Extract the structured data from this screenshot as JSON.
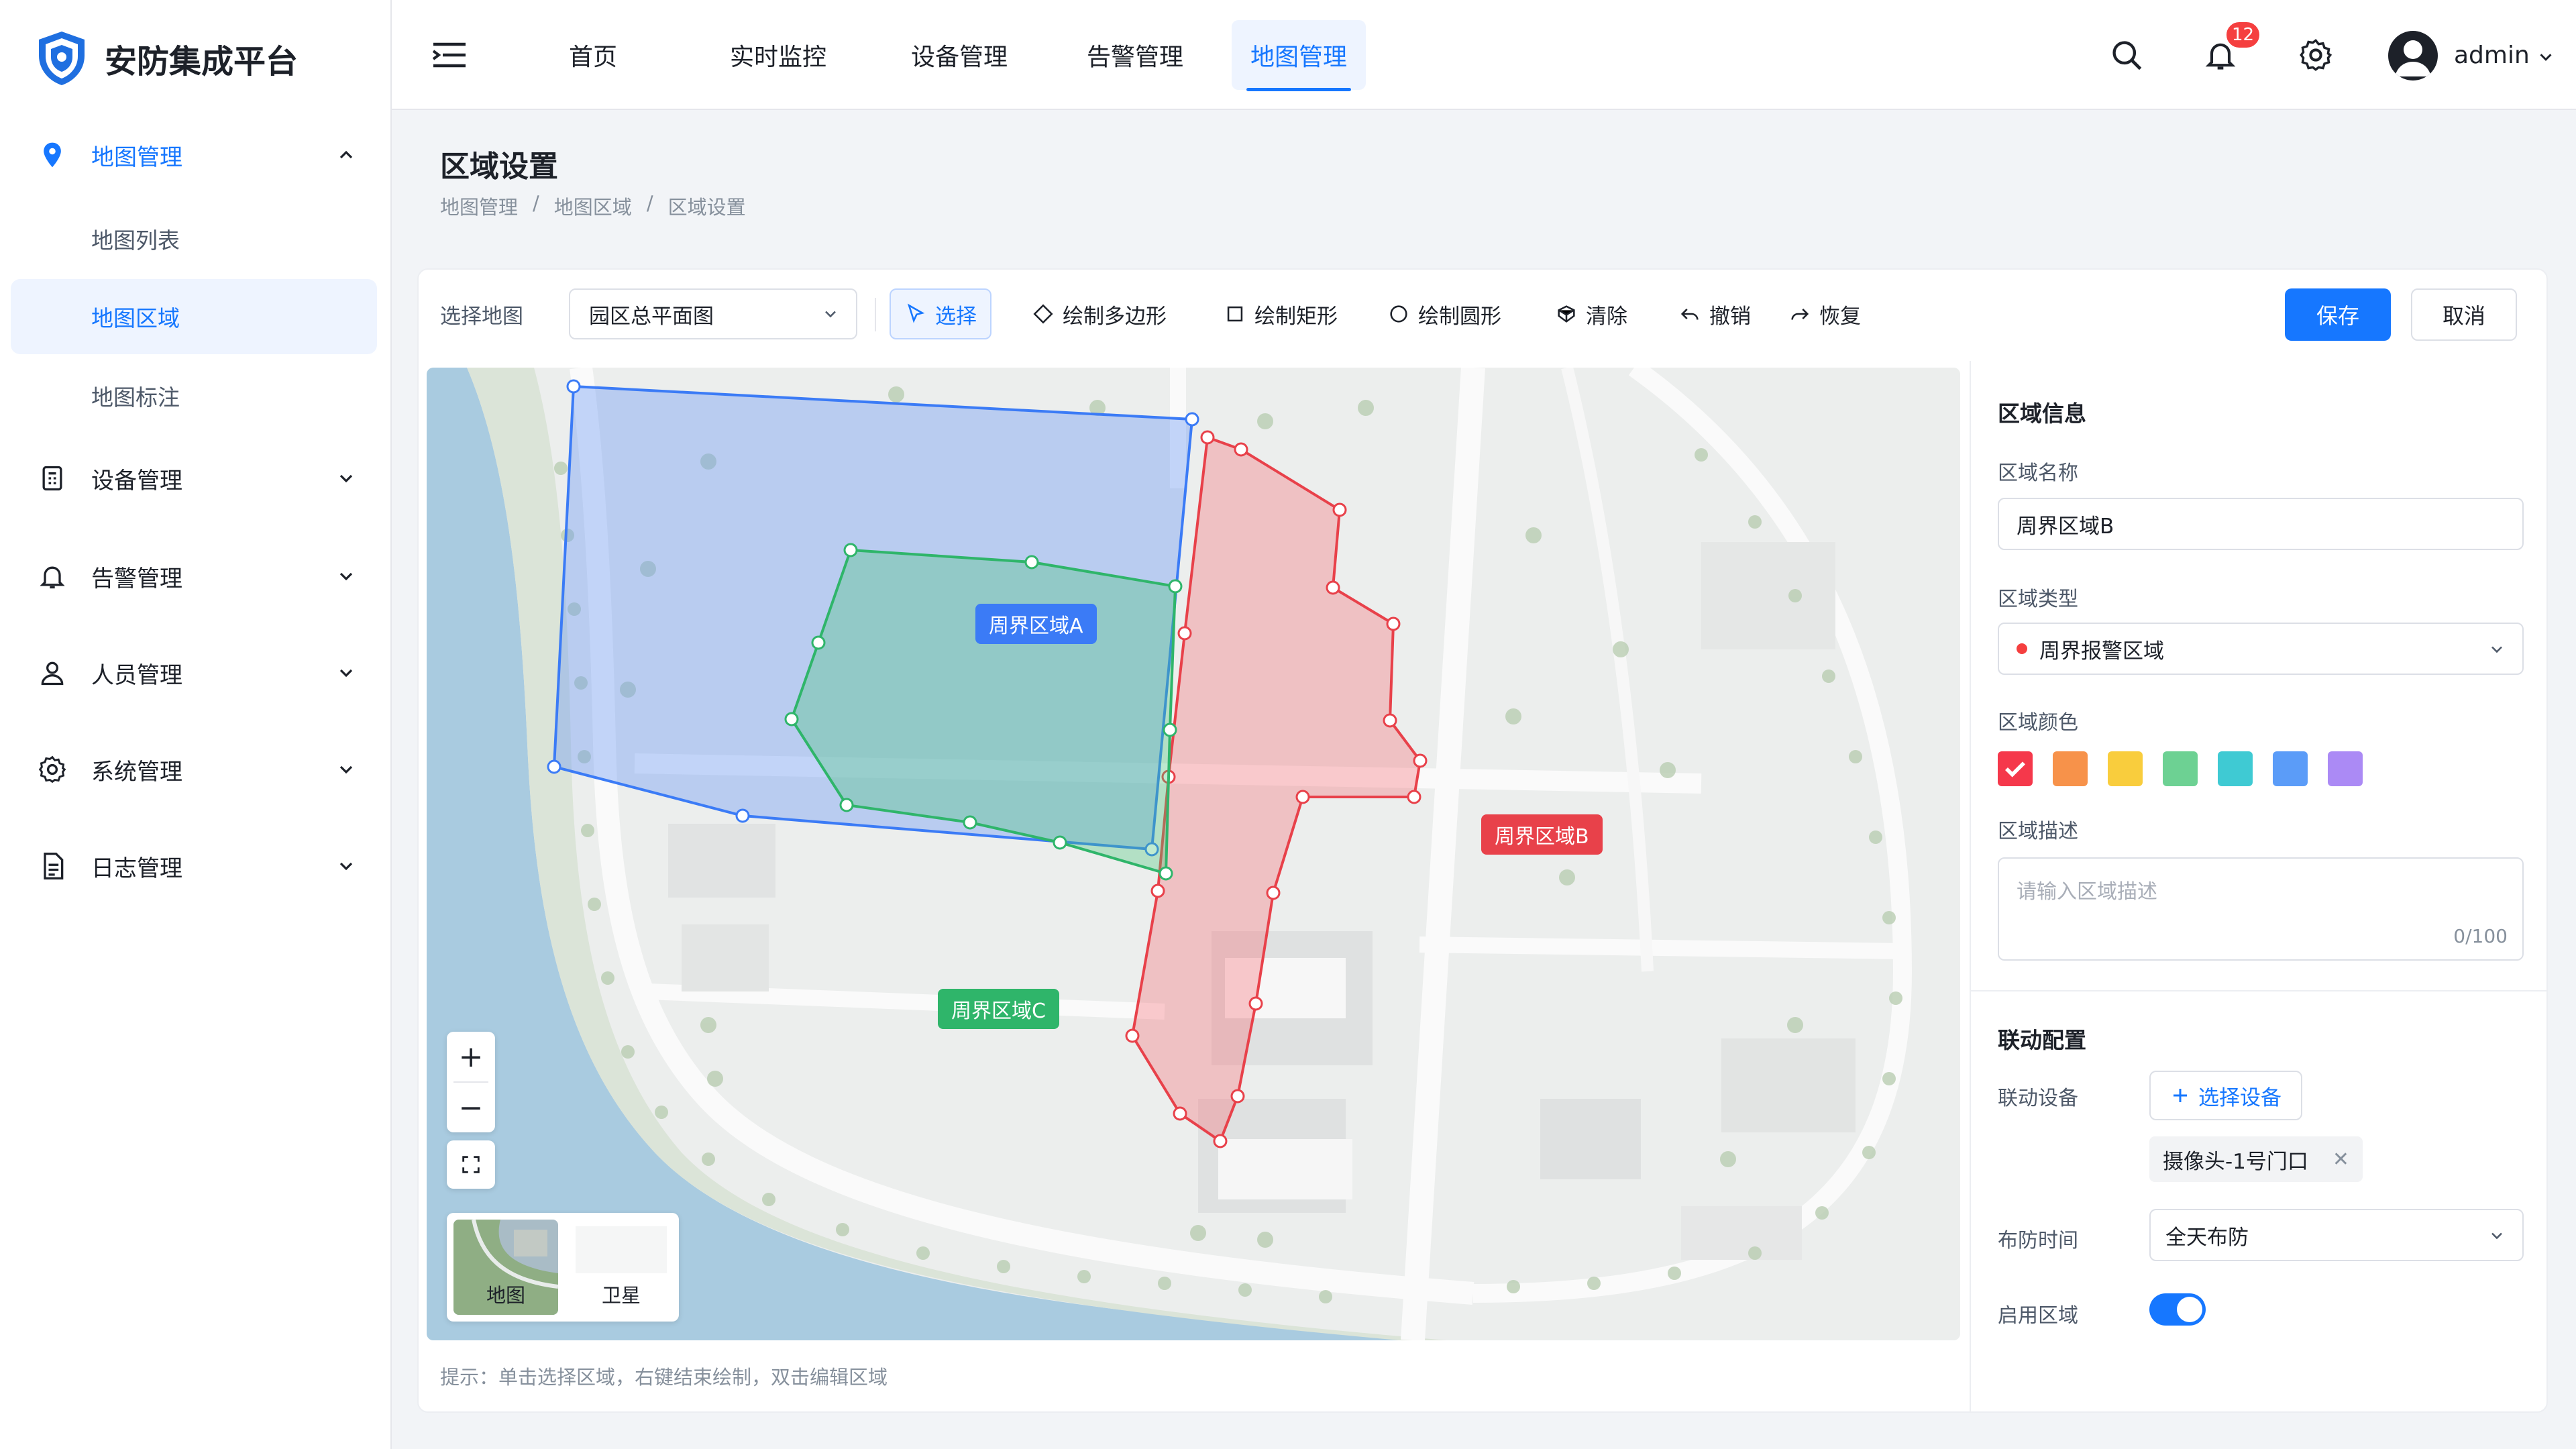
{
  "app": {
    "title": "安防集成平台"
  },
  "sidebar": {
    "items": [
      {
        "label": "地图管理",
        "icon": "location-pin-icon",
        "expanded": true,
        "children": [
          {
            "label": "地图列表"
          },
          {
            "label": "地图区域",
            "active": true
          },
          {
            "label": "地图标注"
          }
        ]
      },
      {
        "label": "设备管理",
        "icon": "device-icon"
      },
      {
        "label": "告警管理",
        "icon": "bell-icon"
      },
      {
        "label": "人员管理",
        "icon": "user-icon"
      },
      {
        "label": "系统管理",
        "icon": "gear-icon"
      },
      {
        "label": "日志管理",
        "icon": "document-icon"
      }
    ]
  },
  "topnav": {
    "tabs": [
      {
        "label": "首页"
      },
      {
        "label": "实时监控"
      },
      {
        "label": "设备管理"
      },
      {
        "label": "告警管理"
      },
      {
        "label": "地图管理",
        "active": true
      }
    ],
    "notification_count": "12",
    "username": "admin"
  },
  "page": {
    "title": "区域设置",
    "breadcrumb": [
      "地图管理",
      "/",
      "地图区域",
      "/",
      "区域设置"
    ]
  },
  "toolbar": {
    "select_map_label": "选择地图",
    "map_value": "园区总平面图",
    "tools": {
      "select": "选择",
      "polygon": "绘制多边形",
      "rect": "绘制矩形",
      "circle": "绘制圆形",
      "clear": "清除",
      "undo": "撤销",
      "redo": "恢复"
    },
    "save": "保存",
    "cancel": "取消"
  },
  "map": {
    "zones": [
      {
        "name": "周界区域A",
        "color": "#3b7bf6"
      },
      {
        "name": "周界区域B",
        "color": "#e8414a"
      },
      {
        "name": "周界区域C",
        "color": "#2fb56a"
      }
    ],
    "zoom_in": "+",
    "zoom_out": "−",
    "layers": [
      {
        "label": "地图",
        "active": true
      },
      {
        "label": "卫星"
      }
    ]
  },
  "hint": "提示：单击选择区域，右键结束绘制，双击编辑区域",
  "panel": {
    "info_title": "区域信息",
    "name_label": "区域名称",
    "name_value": "周界区域B",
    "type_label": "区域类型",
    "type_value": "周界报警区域",
    "color_label": "区域颜色",
    "colors": [
      "#f5384b",
      "#f7924a",
      "#f9cd3d",
      "#6dd193",
      "#3fcad3",
      "#5b9cf8",
      "#ab8af5"
    ],
    "selected_color": "#f5384b",
    "desc_label": "区域描述",
    "desc_placeholder": "请输入区域描述",
    "desc_count": "0/100",
    "link_title": "联动配置",
    "device_label": "联动设备",
    "device_button": "选择设备",
    "device_tag": "摄像头-1号门口",
    "time_label": "布防时间",
    "time_value": "全天布防",
    "enable_label": "启用区域",
    "enabled": true
  }
}
